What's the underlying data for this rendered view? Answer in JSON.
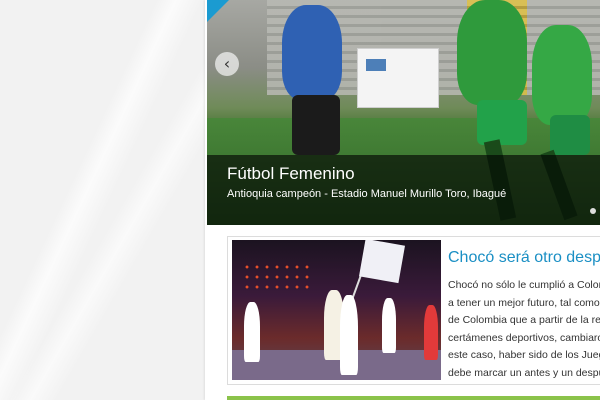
{
  "slider": {
    "title": "Fútbol Femenino",
    "subtitle": "Antioquia campeón - Estadio Manuel Murillo Toro, Ibagué",
    "prev_icon": "‹"
  },
  "article": {
    "title": "Chocó será otro despue",
    "lines": [
      "Chocó no sólo le cumplió a Colomb",
      "a tener un mejor futuro, tal como ha",
      "de Colombia que a partir de la real",
      "certámenes deportivos, cambiaron",
      "este caso, haber sido de los Juego",
      "debe marcar un antes y un despué"
    ]
  },
  "colors": {
    "accent": "#1a8fc4",
    "green_bar": "#8bc34a"
  }
}
